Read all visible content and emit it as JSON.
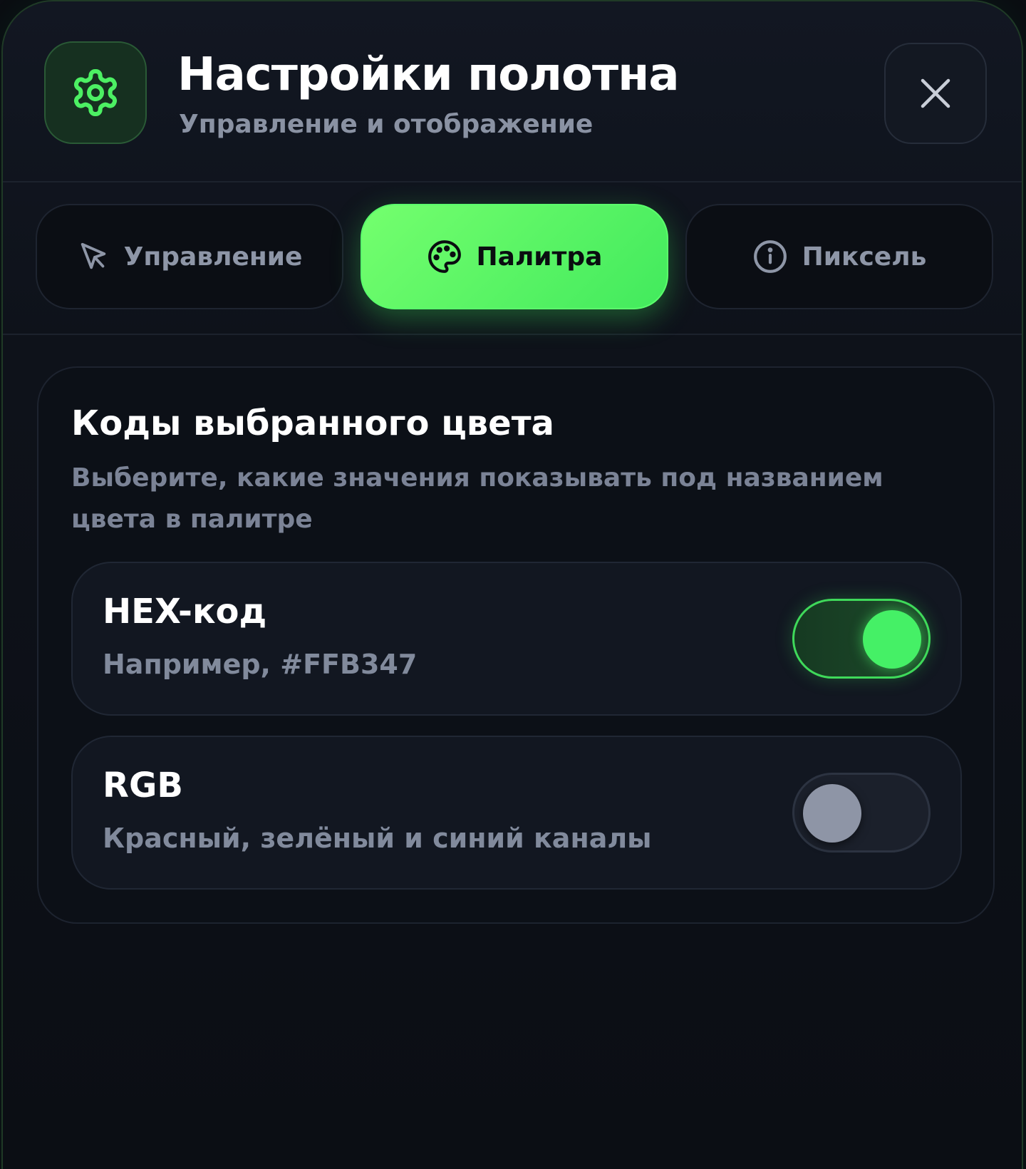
{
  "header": {
    "title": "Настройки полотна",
    "subtitle": "Управление и отображение",
    "icon": "gear-icon",
    "close_icon": "close-icon"
  },
  "tabs": [
    {
      "label": "Управление",
      "icon": "cursor-icon",
      "active": false
    },
    {
      "label": "Палитра",
      "icon": "palette-icon",
      "active": true
    },
    {
      "label": "Пиксель",
      "icon": "info-icon",
      "active": false
    }
  ],
  "section": {
    "title": "Коды выбранного цвета",
    "description": "Выберите, какие значения показывать под названием цвета в палитре",
    "options": [
      {
        "title": "HEX-код",
        "description": "Например, #FFB347",
        "enabled": true
      },
      {
        "title": "RGB",
        "description": "Красный, зелёный и синий каналы",
        "enabled": false
      }
    ]
  },
  "colors": {
    "accent": "#4CF063",
    "background": "#0B0E14",
    "text_primary": "#FFFFFF",
    "text_secondary": "#818A9C"
  }
}
